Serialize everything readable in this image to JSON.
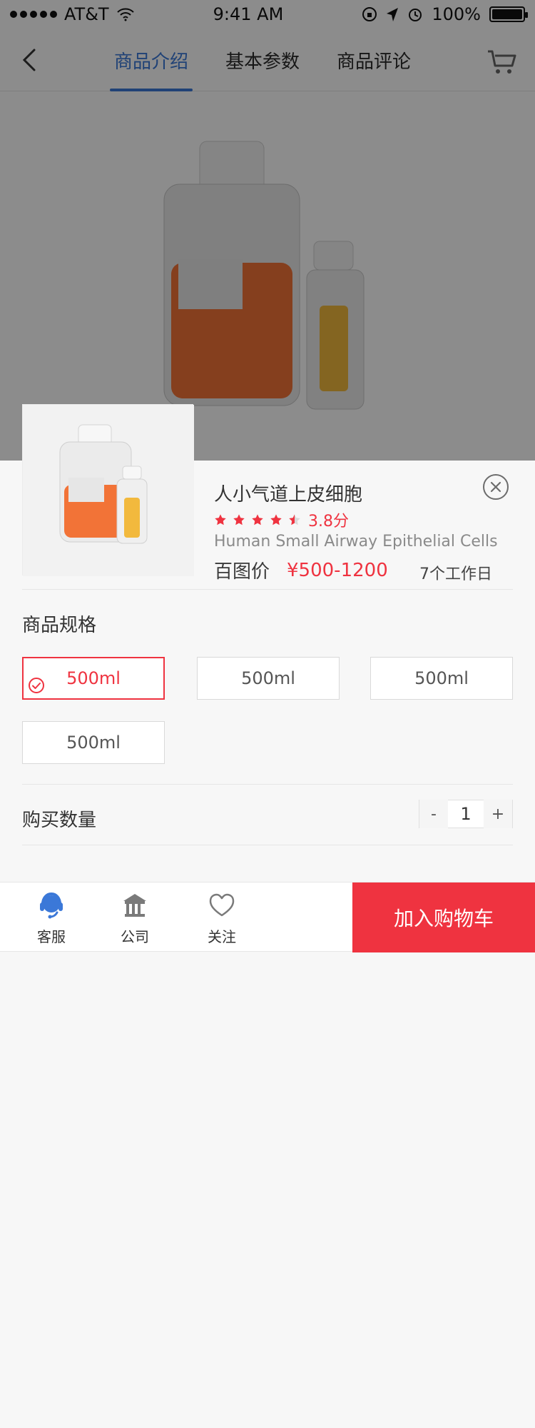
{
  "status": {
    "carrier": "AT&T",
    "time": "9:41 AM",
    "battery": "100%"
  },
  "nav": {
    "tabs": [
      {
        "label": "商品介绍"
      },
      {
        "label": "基本参数"
      },
      {
        "label": "商品评论"
      }
    ]
  },
  "product": {
    "title": "人小气道上皮细胞",
    "rating_score": "3.8分",
    "subtitle": "Human Small Airway Epithelial Cells",
    "price_label": "百图价",
    "price_value": "¥500-1200",
    "lead_time": "7个工作日"
  },
  "specs": {
    "title": "商品规格",
    "options": [
      {
        "label": "500ml",
        "selected": true
      },
      {
        "label": "500ml",
        "selected": false
      },
      {
        "label": "500ml",
        "selected": false
      },
      {
        "label": "500ml",
        "selected": false
      }
    ]
  },
  "quantity": {
    "title": "购买数量",
    "value": "1",
    "minus": "-",
    "plus": "+"
  },
  "bottom_bar": {
    "service": "客服",
    "company": "公司",
    "follow": "关注",
    "add_to_cart": "加入购物车"
  },
  "colors": {
    "accent": "#3b78d8",
    "price_red": "#ef3340"
  },
  "icons": {
    "back": "chevron-left-icon",
    "cart": "cart-icon",
    "close": "close-circle-icon",
    "star": "star-icon",
    "check": "check-circle-icon",
    "service": "headset-icon",
    "company": "bank-icon",
    "follow": "heart-icon"
  }
}
